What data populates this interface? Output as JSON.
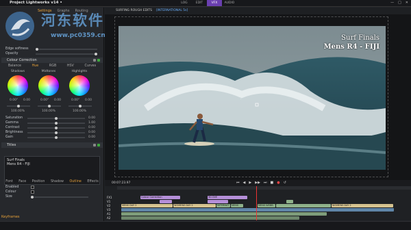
{
  "app": {
    "title": "Project Lightworks v14 •",
    "window_controls": [
      "—",
      "□",
      "✕"
    ]
  },
  "top_tabs": [
    {
      "label": "LOG",
      "active": false
    },
    {
      "label": "EDIT",
      "active": false
    },
    {
      "label": "VFX",
      "active": true
    },
    {
      "label": "AUDIO",
      "active": false
    }
  ],
  "watermark": {
    "text": "河东软件园",
    "url": "www.pc0359.cn"
  },
  "left_panel": {
    "tabs": [
      {
        "label": "Settings",
        "active": true
      },
      {
        "label": "Graphs",
        "active": false
      },
      {
        "label": "Routing",
        "active": false
      }
    ],
    "top_rows": [
      {
        "label": "Edge softness"
      },
      {
        "label": "Opacity"
      }
    ],
    "colour_correction": {
      "header": "Colour Correction",
      "tabs": [
        {
          "label": "Balance",
          "active": false
        },
        {
          "label": "Hue",
          "active": true
        },
        {
          "label": "RGB",
          "active": false
        },
        {
          "label": "HSV",
          "active": false
        },
        {
          "label": "Curves",
          "active": false
        }
      ],
      "wheels": [
        {
          "label": "Shadows",
          "deg": "0.00°",
          "amt": "0.00",
          "pct": "100.00%"
        },
        {
          "label": "Midtones",
          "deg": "0.00°",
          "amt": "0.00",
          "pct": "100.00%"
        },
        {
          "label": "Highlights",
          "deg": "0.00°",
          "amt": "0.00",
          "pct": "100.00%"
        }
      ],
      "params": [
        {
          "label": "Saturation",
          "value": "0.00",
          "level": 0.5
        },
        {
          "label": "Gamma",
          "value": "1.00",
          "level": 0.5
        },
        {
          "label": "Contrast",
          "value": "0.00",
          "level": 0.5
        },
        {
          "label": "Brightness",
          "value": "0.00",
          "level": 0.5
        },
        {
          "label": "Gain",
          "value": "0.00",
          "level": 0.5
        }
      ]
    },
    "titles": {
      "header": "Titles",
      "text_line1": "Surf Finals",
      "text_line2": "Mens R4 - FIJI",
      "tabs": [
        {
          "label": "Font",
          "active": false
        },
        {
          "label": "Face",
          "active": false
        },
        {
          "label": "Position",
          "active": false
        },
        {
          "label": "Shadow",
          "active": false
        },
        {
          "label": "Outline",
          "active": true
        },
        {
          "label": "Effects",
          "active": false
        }
      ],
      "rows": [
        {
          "label": "Enabled"
        },
        {
          "label": "Colour"
        },
        {
          "label": "Size"
        }
      ]
    },
    "keyframes_label": "Keyframes"
  },
  "viewer": {
    "header_left": "SURFING ROUGH EDITS",
    "header_right": "[INTERNATIONAL 5s]",
    "overlay_line1": "Surf Finals",
    "overlay_line2": "Mens R4 - FIJI",
    "timecode": "00:07:23.97",
    "transport": [
      "⏮",
      "◀",
      "▶",
      "▶▶",
      "⏭",
      "■",
      "●",
      "↺"
    ]
  },
  "timeline": {
    "tracks": [
      "FX1",
      "V1",
      "V2",
      "V3",
      "A1",
      "A2",
      "A3",
      "A4"
    ],
    "clips_v": [
      {
        "label": "Colour Correction",
        "track": 0,
        "cls": "c-p"
      },
      {
        "label": "3D DVE",
        "track": 0,
        "cls": "c-p"
      },
      {
        "label": "MENS DAY 2",
        "track": 2,
        "cls": "c-y"
      },
      {
        "label": "WOMENS DAY 2",
        "track": 2,
        "cls": "c-y"
      },
      {
        "label": "INTERNAT",
        "track": 2,
        "cls": "c-g"
      },
      {
        "label": "MENS",
        "track": 2,
        "cls": "c-g"
      },
      {
        "label": "MENS WEBB",
        "track": 2,
        "cls": "c-g"
      },
      {
        "label": "WOMENS DAY 2",
        "track": 2,
        "cls": "c-y"
      }
    ]
  },
  "colors": {
    "accent": "#6a3fb0",
    "highlight": "#e8a23a",
    "playhead": "#e33333"
  }
}
